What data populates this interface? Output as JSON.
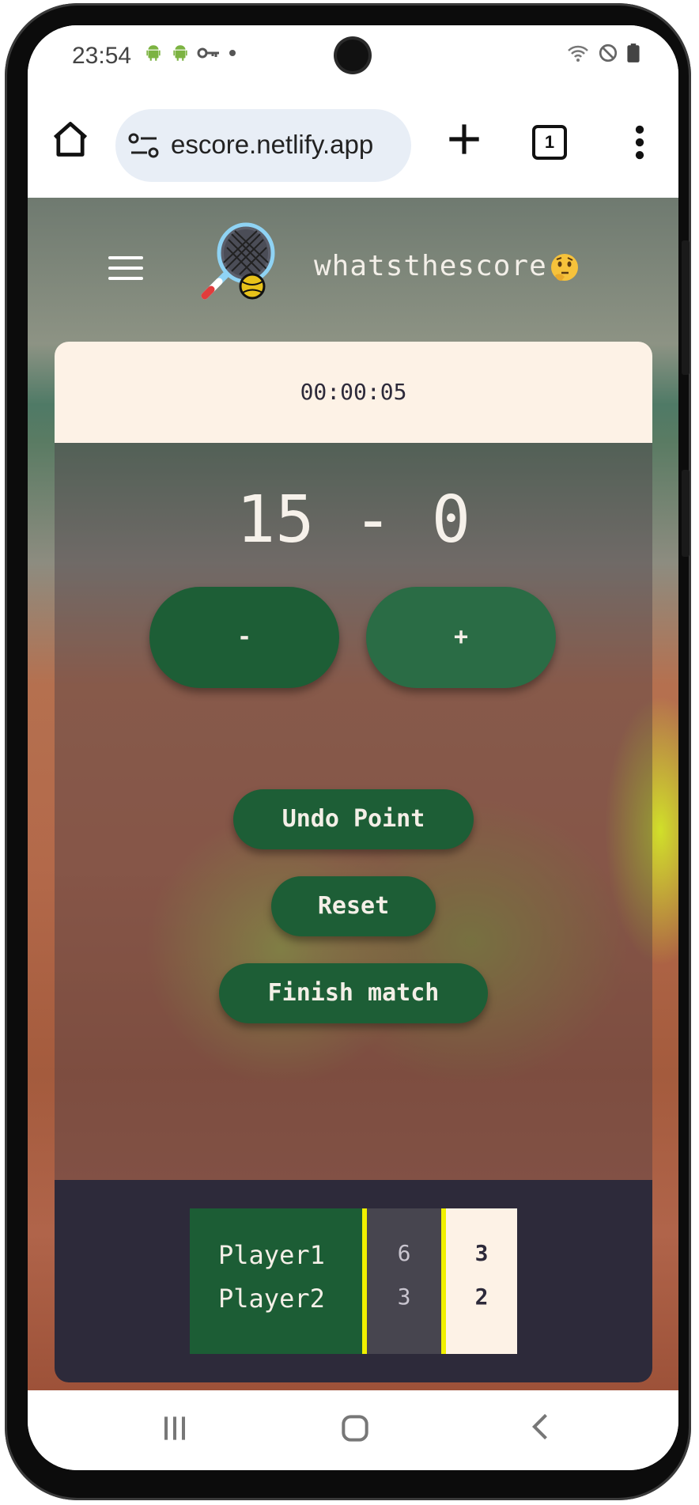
{
  "statusbar": {
    "time": "23:54",
    "left_icons": [
      "android-icon",
      "android-icon",
      "key-icon",
      "dot-icon"
    ],
    "right_icons": [
      "wifi-icon",
      "do-not-disturb-icon",
      "battery-icon"
    ]
  },
  "browser": {
    "url": "escore.netlify.app",
    "tab_count": "1",
    "icons": [
      "home-icon",
      "site-settings-icon",
      "new-tab-icon",
      "tab-switcher-icon",
      "more-menu-icon"
    ]
  },
  "app": {
    "brand": "whatsthescore",
    "timer": "00:00:05",
    "score": "15 - 0",
    "buttons": {
      "minus": "-",
      "plus": "+",
      "undo": "Undo Point",
      "reset": "Reset",
      "finish": "Finish match"
    },
    "scoreboard": {
      "players": [
        {
          "name": "Player1",
          "sets": "6",
          "games": "3"
        },
        {
          "name": "Player2",
          "sets": "3",
          "games": "2"
        }
      ]
    },
    "colors": {
      "button_green": "#1d5e36",
      "cream": "#fdf2e6",
      "dark": "#2d2a3a",
      "highlight": "#f0f000"
    }
  },
  "system_nav": {
    "icons": [
      "recent-apps-icon",
      "home-circle-icon",
      "back-icon"
    ]
  }
}
